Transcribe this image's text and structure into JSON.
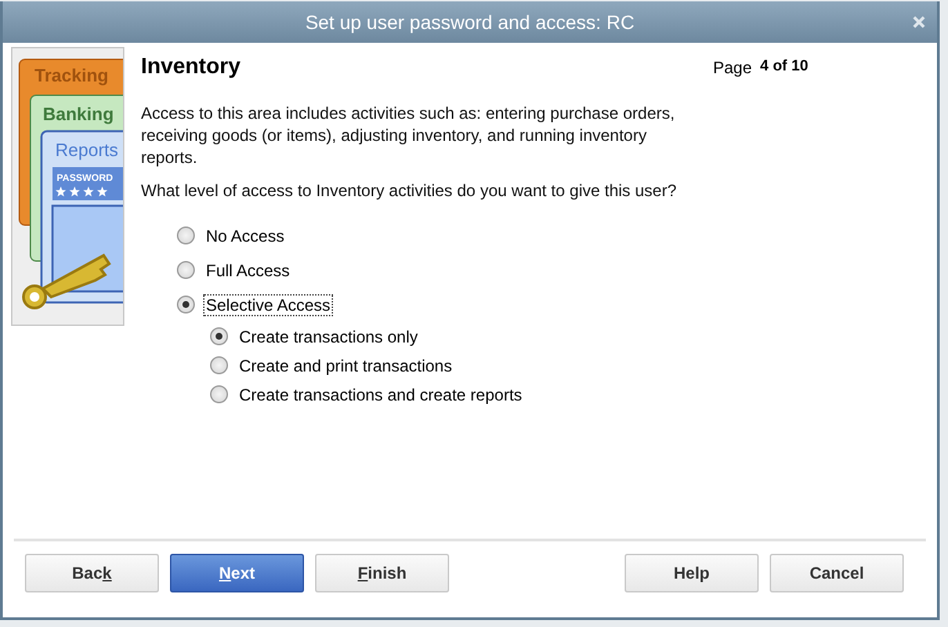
{
  "window": {
    "title": "Set up user password and access: RC"
  },
  "illustration": {
    "labels": [
      "Tracking",
      "Banking",
      "Reports",
      "PASSWORD"
    ]
  },
  "heading": "Inventory",
  "page": {
    "label": "Page",
    "value": "4 of 10"
  },
  "description": "Access to this area includes activities such as: entering purchase orders, receiving goods (or items), adjusting inventory, and running inventory reports.",
  "question": "What level of access to Inventory activities do you want to give this user?",
  "access_options": [
    {
      "label": "No Access",
      "selected": false
    },
    {
      "label": "Full Access",
      "selected": false
    },
    {
      "label": "Selective Access",
      "selected": true,
      "focused": true
    }
  ],
  "selective_options": [
    {
      "label": "Create transactions only",
      "selected": true
    },
    {
      "label": "Create and print transactions",
      "selected": false
    },
    {
      "label": "Create transactions and create reports",
      "selected": false
    }
  ],
  "left_buttons": [
    {
      "before": "Bac",
      "key": "k",
      "kind": "default"
    },
    {
      "key": "N",
      "after": "ext",
      "kind": "primary"
    },
    {
      "key": "F",
      "after": "inish",
      "kind": "default"
    }
  ],
  "right_buttons": [
    {
      "before": "Help"
    },
    {
      "before": "Cancel"
    }
  ]
}
